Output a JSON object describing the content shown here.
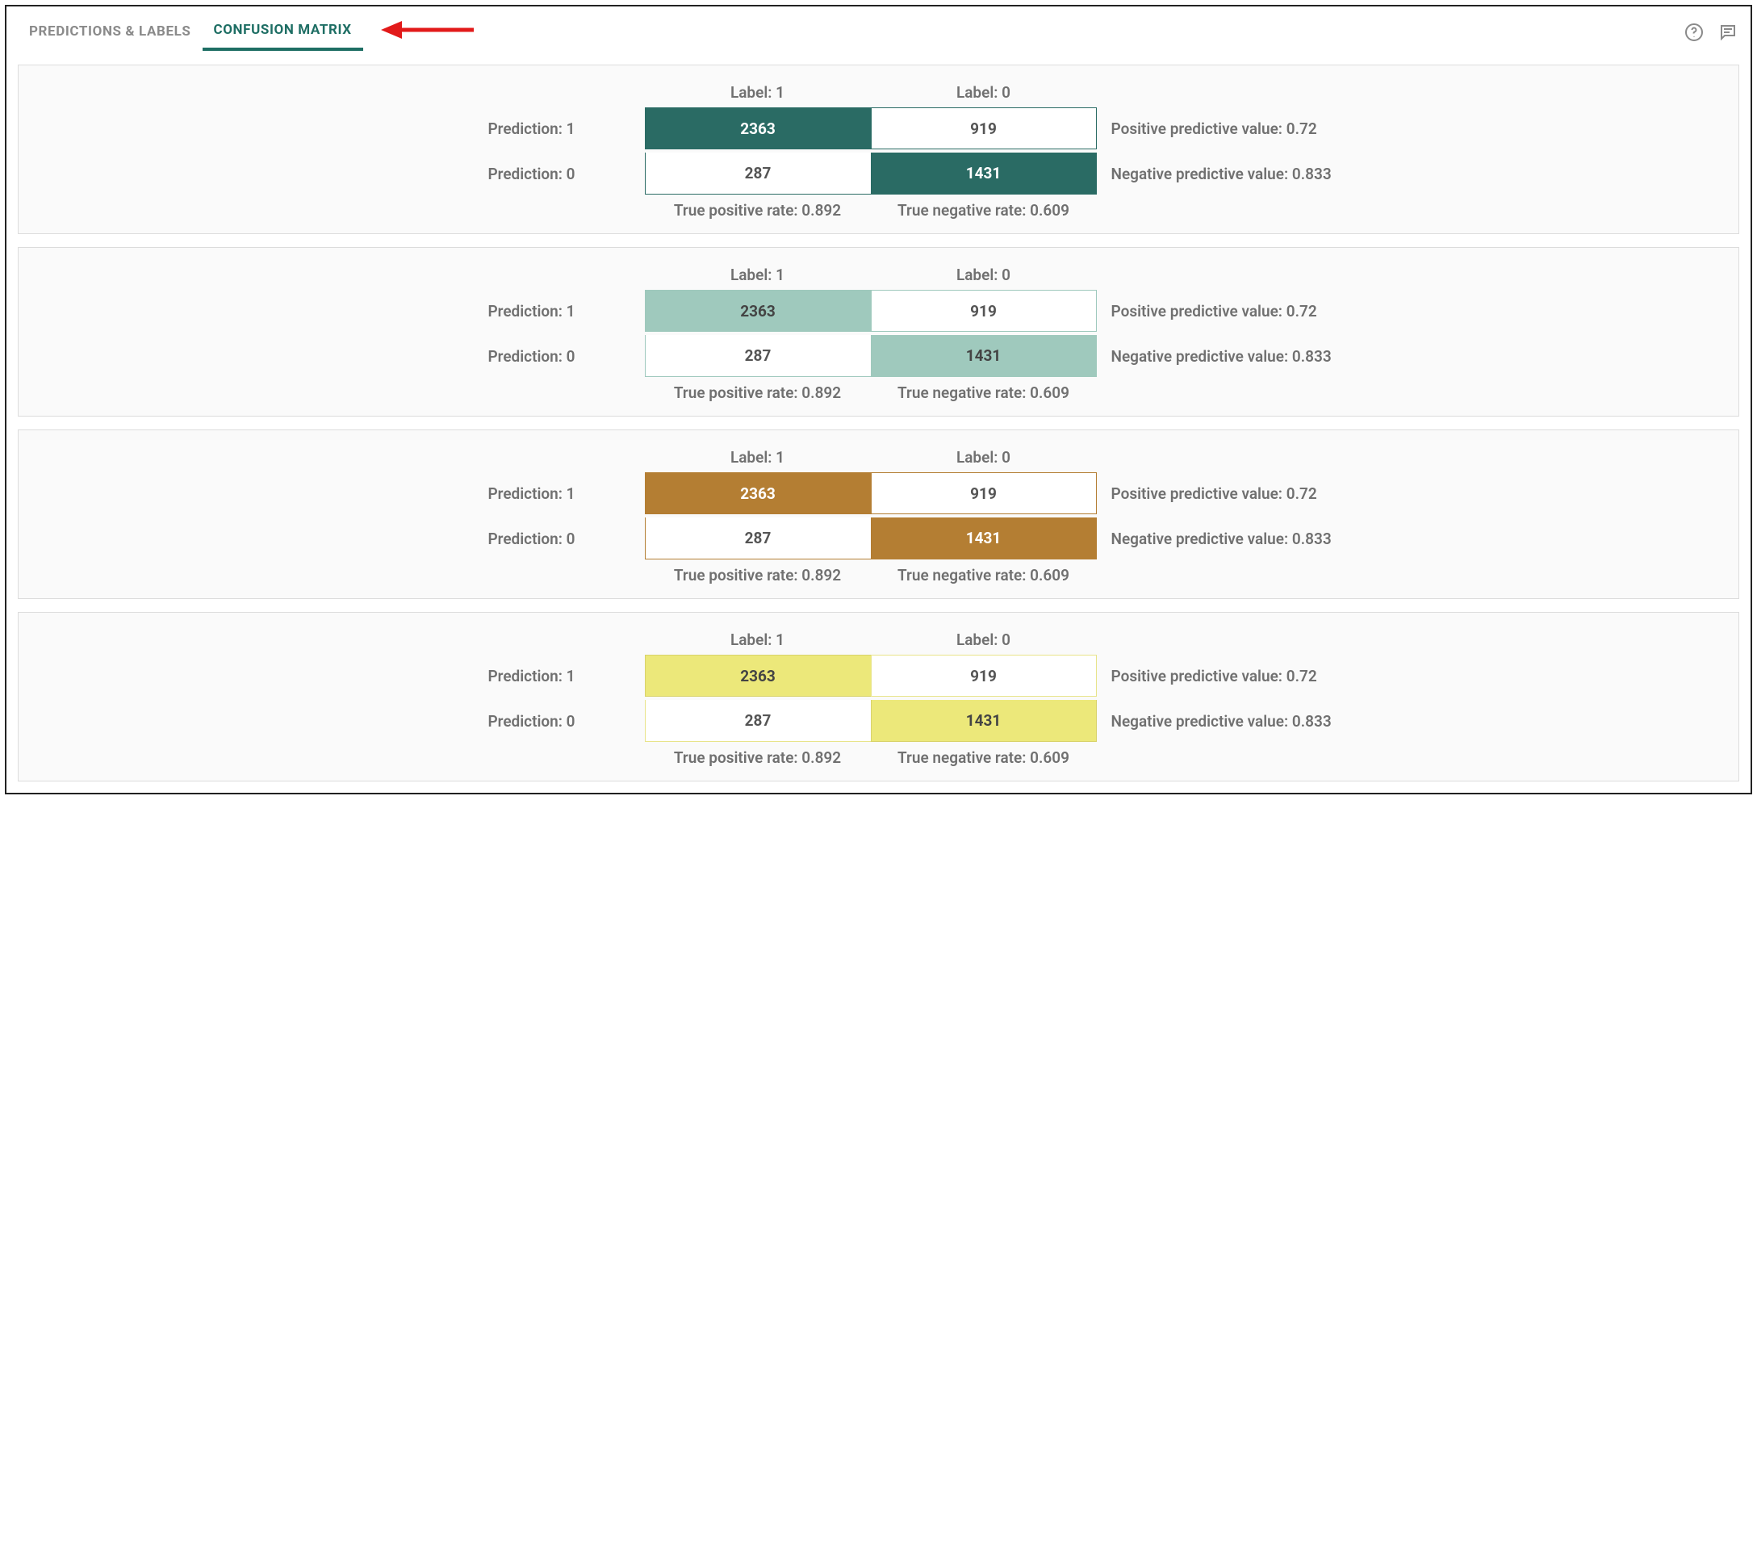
{
  "tabs": {
    "predictions_labels": "PREDICTIONS & LABELS",
    "confusion_matrix": "CONFUSION MATRIX"
  },
  "labels": {
    "label1": "Label: 1",
    "label0": "Label: 0",
    "pred1": "Prediction: 1",
    "pred0": "Prediction: 0",
    "tpr_prefix": "True positive rate: ",
    "tnr_prefix": "True negative rate: ",
    "ppv_prefix": "Positive predictive value: ",
    "npv_prefix": "Negative predictive value: "
  },
  "matrices": [
    {
      "tp": 2363,
      "fp": 919,
      "fn": 287,
      "tn": 1431,
      "ppv": 0.72,
      "npv": 0.833,
      "tpr": 0.892,
      "tnr": 0.609
    },
    {
      "tp": 2363,
      "fp": 919,
      "fn": 287,
      "tn": 1431,
      "ppv": 0.72,
      "npv": 0.833,
      "tpr": 0.892,
      "tnr": 0.609
    },
    {
      "tp": 2363,
      "fp": 919,
      "fn": 287,
      "tn": 1431,
      "ppv": 0.72,
      "npv": 0.833,
      "tpr": 0.892,
      "tnr": 0.609
    },
    {
      "tp": 2363,
      "fp": 919,
      "fn": 287,
      "tn": 1431,
      "ppv": 0.72,
      "npv": 0.833,
      "tpr": 0.892,
      "tnr": 0.609
    }
  ],
  "colors": {
    "variants": [
      "#2a6b64",
      "#9fc9bd",
      "#b47e33",
      "#ece87a"
    ]
  },
  "chart_data": [
    {
      "type": "table",
      "title": "Confusion Matrix variant 1",
      "matrix": [
        [
          2363,
          919
        ],
        [
          287,
          1431
        ]
      ],
      "row_labels": [
        "Prediction: 1",
        "Prediction: 0"
      ],
      "col_labels": [
        "Label: 1",
        "Label: 0"
      ],
      "metrics": {
        "ppv": 0.72,
        "npv": 0.833,
        "tpr": 0.892,
        "tnr": 0.609
      },
      "accent": "#2a6b64"
    },
    {
      "type": "table",
      "title": "Confusion Matrix variant 2",
      "matrix": [
        [
          2363,
          919
        ],
        [
          287,
          1431
        ]
      ],
      "row_labels": [
        "Prediction: 1",
        "Prediction: 0"
      ],
      "col_labels": [
        "Label: 1",
        "Label: 0"
      ],
      "metrics": {
        "ppv": 0.72,
        "npv": 0.833,
        "tpr": 0.892,
        "tnr": 0.609
      },
      "accent": "#9fc9bd"
    },
    {
      "type": "table",
      "title": "Confusion Matrix variant 3",
      "matrix": [
        [
          2363,
          919
        ],
        [
          287,
          1431
        ]
      ],
      "row_labels": [
        "Prediction: 1",
        "Prediction: 0"
      ],
      "col_labels": [
        "Label: 1",
        "Label: 0"
      ],
      "metrics": {
        "ppv": 0.72,
        "npv": 0.833,
        "tpr": 0.892,
        "tnr": 0.609
      },
      "accent": "#b47e33"
    },
    {
      "type": "table",
      "title": "Confusion Matrix variant 4",
      "matrix": [
        [
          2363,
          919
        ],
        [
          287,
          1431
        ]
      ],
      "row_labels": [
        "Prediction: 1",
        "Prediction: 0"
      ],
      "col_labels": [
        "Label: 1",
        "Label: 0"
      ],
      "metrics": {
        "ppv": 0.72,
        "npv": 0.833,
        "tpr": 0.892,
        "tnr": 0.609
      },
      "accent": "#ece87a"
    }
  ]
}
